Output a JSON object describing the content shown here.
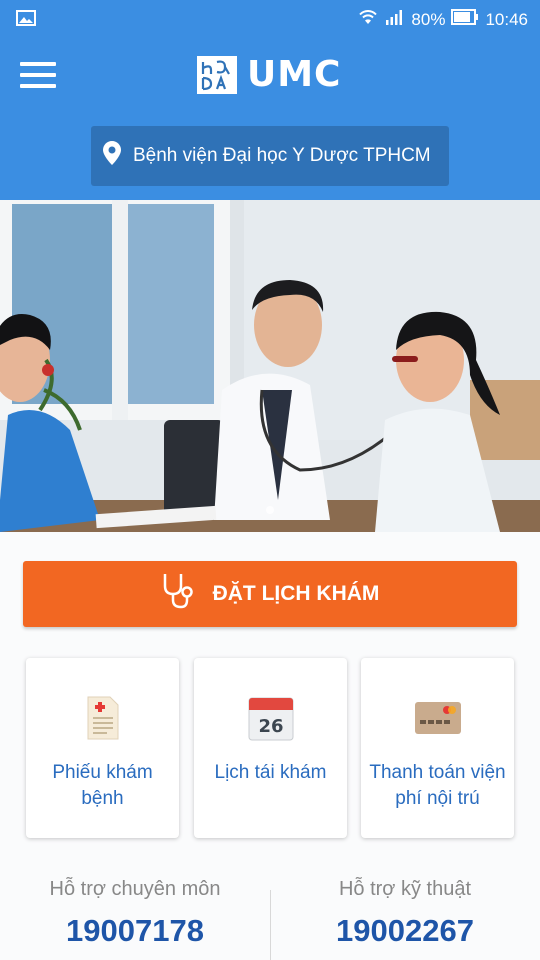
{
  "status_bar": {
    "battery_percent": "80%",
    "time": "10:46"
  },
  "header": {
    "app_name": "UMC",
    "location": "Bệnh viện Đại học Y Dược TPHCM"
  },
  "booking": {
    "label": "ĐẶT LỊCH KHÁM"
  },
  "cards": [
    {
      "label": "Phiếu khám bệnh",
      "icon": "medical-record-icon"
    },
    {
      "label": "Lịch tái khám",
      "icon": "calendar-icon",
      "icon_text": "26"
    },
    {
      "label": "Thanh toán viện phí nội trú",
      "icon": "credit-card-icon"
    }
  ],
  "support": {
    "professional": {
      "title": "Hỗ trợ chuyên môn",
      "phone": "19007178"
    },
    "technical": {
      "title": "Hỗ trợ kỹ thuật",
      "phone": "19002267"
    }
  },
  "colors": {
    "primary_blue": "#3b8ee2",
    "location_blue": "#2f72b7",
    "accent_orange": "#f26722",
    "link_blue": "#2a6cbf",
    "phone_blue": "#1e55a8"
  }
}
